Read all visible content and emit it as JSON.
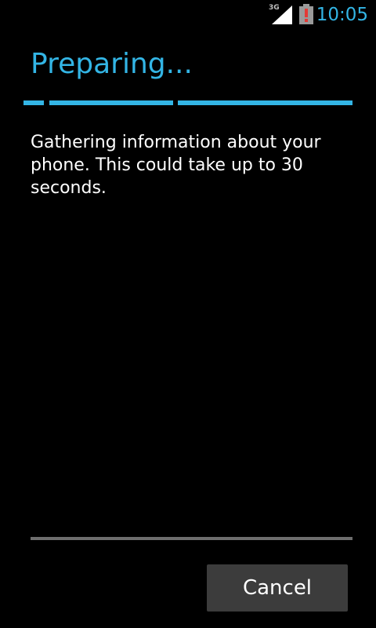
{
  "status_bar": {
    "network_type": "3G",
    "clock": "10:05",
    "icons": [
      "signal-icon",
      "battery-alert-icon"
    ],
    "accent_color": "#33b5e5",
    "battery_alert_color": "#e53935"
  },
  "header": {
    "title": "Preparing...",
    "progress_indicator": "indeterminate"
  },
  "body": {
    "message": "Gathering information about your phone. This could take up to 30 seconds."
  },
  "footer": {
    "cancel_label": "Cancel"
  }
}
